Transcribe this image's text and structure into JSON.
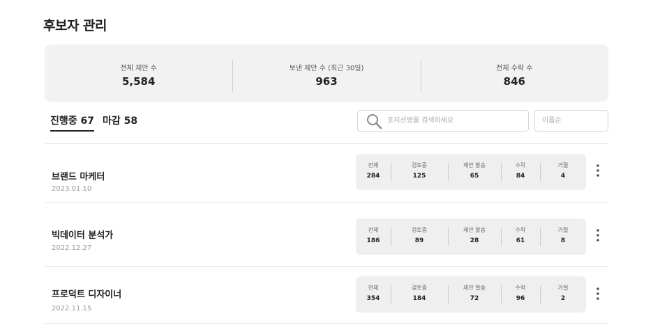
{
  "page": {
    "title": "후보자 관리"
  },
  "summary": [
    {
      "label": "전체 제안 수",
      "value": "5,584"
    },
    {
      "label": "보낸 제안 수 (최근 30일)",
      "value": "963"
    },
    {
      "label": "전체 수락 수",
      "value": "846"
    }
  ],
  "tabs": [
    {
      "label": "진행중 67",
      "active": true
    },
    {
      "label": "마감 58",
      "active": false
    }
  ],
  "search": {
    "placeholder": "포지션명을 검색하세요",
    "value": ""
  },
  "sort": {
    "label": "이름순"
  },
  "stat_labels": [
    "전체",
    "검토중",
    "제안 발송",
    "수락",
    "거절"
  ],
  "rows": [
    {
      "title": "브랜드 마케터",
      "date": "2023.01.10",
      "stats": [
        "284",
        "125",
        "65",
        "84",
        "4"
      ]
    },
    {
      "title": "빅데이터 분석가",
      "date": "2022.12.27",
      "stats": [
        "186",
        "89",
        "28",
        "61",
        "8"
      ]
    },
    {
      "title": "프로덕트 디자이너",
      "date": "2022.11.15",
      "stats": [
        "354",
        "184",
        "72",
        "96",
        "2"
      ]
    }
  ],
  "icons": {
    "search": "search-icon",
    "more": "more-vertical-icon"
  },
  "colors": {
    "summary_bg": "#f2f2f2",
    "stats_bg": "#efefef",
    "text": "#222222",
    "muted": "#999999",
    "border": "#d6d6d6"
  }
}
